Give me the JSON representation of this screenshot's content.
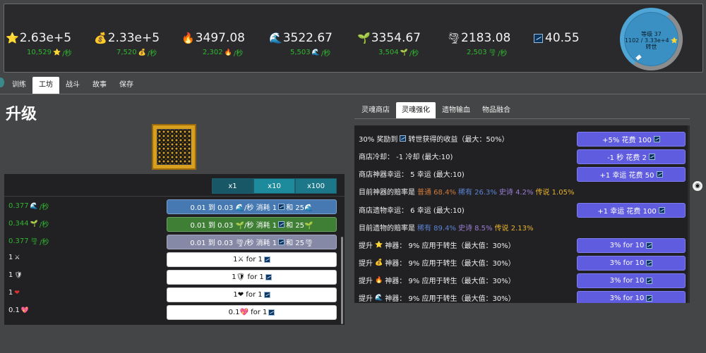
{
  "resources": [
    {
      "icon": "⭐",
      "name": "star",
      "value": "2.63e+5",
      "rate": "10,529⭐/秒",
      "rate_num": "10,529",
      "rate_icon": "⭐",
      "rate_unit": "/秒"
    },
    {
      "icon": "💰",
      "name": "gold",
      "value": "2.33e+5",
      "rate_num": "7,520",
      "rate_icon": "💰",
      "rate_unit": "/秒"
    },
    {
      "icon": "🔥",
      "name": "fire",
      "value": "3497.08",
      "rate_num": "2,302",
      "rate_icon": "🔥",
      "rate_unit": "/秒"
    },
    {
      "icon": "🌊",
      "name": "water",
      "value": "3522.67",
      "rate_num": "5,503",
      "rate_icon": "🌊",
      "rate_unit": "/秒"
    },
    {
      "icon": "🌱",
      "name": "earth",
      "value": "3354.67",
      "rate_num": "3,504",
      "rate_icon": "🌱",
      "rate_unit": "/秒"
    },
    {
      "icon": "🌪",
      "name": "wind",
      "value": "2183.08",
      "rate_num": "2,503",
      "rate_icon": "🌪",
      "rate_unit": "/秒"
    },
    {
      "icon": "soul",
      "name": "soul",
      "value": "40.55"
    }
  ],
  "level": {
    "line1": "等级 37",
    "line2": "1102 / 3.33e+4 ⭐",
    "line3": "转世"
  },
  "main_tabs": [
    "训练",
    "工坊",
    "战斗",
    "故事",
    "保存"
  ],
  "main_active_tab": 1,
  "page_title": "升级",
  "multipliers": [
    "x1",
    "x10",
    "x100"
  ],
  "buy_rows": [
    {
      "left_kind": "rate",
      "left_value": "0.377",
      "left_icon": "🌊",
      "left_unit": "/秒",
      "btn_style": "blue",
      "btn_text": "0.01 到 0.03 🌊/秒 消耗 1",
      "btn_icon2": "soul",
      "btn_text2": "和 25🌊"
    },
    {
      "left_kind": "rate",
      "left_value": "0.344",
      "left_icon": "🌱",
      "left_unit": "/秒",
      "btn_style": "green",
      "btn_text": "0.01 到 0.03 🌱/秒 消耗 1",
      "btn_icon2": "soul",
      "btn_text2": "和 25🌱"
    },
    {
      "left_kind": "rate",
      "left_value": "0.377",
      "left_icon": "🌪",
      "left_unit": "/秒",
      "btn_style": "grey",
      "btn_text": "0.01 到 0.03 🌪/秒 消耗 1",
      "btn_icon2": "soul",
      "btn_text2": "和 25🌪"
    },
    {
      "left_kind": "own",
      "left_value": "1",
      "left_icon": "⚔",
      "btn_style": "white",
      "btn_text": "1⚔ for 1",
      "btn_icon2": "soul",
      "btn_text2": ""
    },
    {
      "left_kind": "own",
      "left_value": "1",
      "left_icon": "🛡",
      "btn_style": "white",
      "btn_text": "1🛡 for 1",
      "btn_icon2": "soul",
      "btn_text2": ""
    },
    {
      "left_kind": "own",
      "left_value": "1",
      "left_icon": "❤",
      "btn_style": "white",
      "btn_text": "1❤ for 1",
      "btn_icon2": "soul",
      "btn_text2": ""
    },
    {
      "left_kind": "own",
      "left_value": "0.1",
      "left_icon": "💖",
      "btn_style": "white",
      "btn_text": "0.1💖 for 1",
      "btn_icon2": "soul",
      "btn_text2": ""
    }
  ],
  "right_tabs": [
    "灵魂商店",
    "灵魂强化",
    "遗物输血",
    "物品融合"
  ],
  "right_active_tab": 1,
  "soul_rows": [
    {
      "text": "30% 奖励到",
      "icon": "soul",
      "text2": "转世获得的收益（最大：50%）",
      "btn": "+5% 花费 100"
    },
    {
      "text": "商店冷却： -1 冷却 (最大:10)",
      "btn": "-1 秒 花费 2"
    },
    {
      "text": "商店神器幸运： 5 幸运 (最大:10)",
      "btn": "+1 幸运 花费 50"
    },
    {
      "text": "目前神器的赔率是",
      "odds": [
        {
          "cls": "c-common",
          "label": "普通 68.4%"
        },
        {
          "cls": "c-rare",
          "label": "稀有 26.3%"
        },
        {
          "cls": "c-epic",
          "label": "史诗 4.2%"
        },
        {
          "cls": "c-legend",
          "label": "传说 1.05%"
        }
      ]
    },
    {
      "text": "商店遗物幸运： 6 幸运 (最大:10)",
      "btn": "+1 幸运 花费 100"
    },
    {
      "text": "目前遗物的赔率是",
      "odds": [
        {
          "cls": "c-rare",
          "label": "稀有 89.4%"
        },
        {
          "cls": "c-epic",
          "label": "史诗 8.5%"
        },
        {
          "cls": "c-legend",
          "label": "传说 2.13%"
        }
      ]
    },
    {
      "text": "提升",
      "icon_emoji": "⭐",
      "text2": "神器： 9% 应用于转生（最大值：30%）",
      "btn": "3% for 10"
    },
    {
      "text": "提升",
      "icon_emoji": "💰",
      "text2": "神器： 9% 应用于转生（最大值：30%）",
      "btn": "3% for 10"
    },
    {
      "text": "提升",
      "icon_emoji": "🔥",
      "text2": "神器： 9% 应用于转生（最大值：30%）",
      "btn": "3% for 10"
    },
    {
      "text": "提升",
      "icon_emoji": "🌊",
      "text2": "神器： 9% 应用于转生（最大值：30%）",
      "btn": "3% for 10"
    }
  ],
  "github_icon": "cat-icon"
}
